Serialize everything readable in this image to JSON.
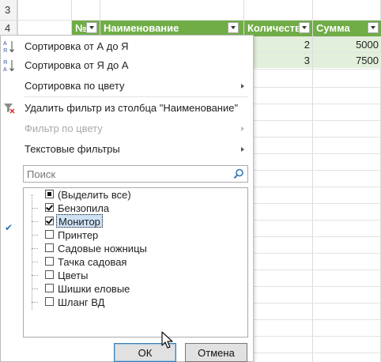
{
  "sheet": {
    "row_numbers": [
      "3",
      "4"
    ],
    "headers": [
      {
        "label": "№"
      },
      {
        "label": "Наименование"
      },
      {
        "label": "Количеств"
      },
      {
        "label": "Сумма"
      }
    ],
    "data_rows": [
      {
        "qty": "2",
        "sum": "5000"
      },
      {
        "qty": "3",
        "sum": "7500"
      }
    ],
    "header_color": "#70ad47",
    "row_band_color": "#e2efda"
  },
  "menu": {
    "sort_asc": "Сортировка от А до Я",
    "sort_desc": "Сортировка от Я до А",
    "sort_color": "Сортировка по цвету",
    "clear_filter": "Удалить фильтр из столбца \"Наименование\"",
    "filter_color": "Фильтр по цвету",
    "text_filters": "Текстовые фильтры",
    "search_placeholder": "Поиск",
    "items": [
      {
        "label": "(Выделить все)",
        "state": "partial"
      },
      {
        "label": "Бензопила",
        "state": "checked"
      },
      {
        "label": "Монитор",
        "state": "checked"
      },
      {
        "label": "Принтер",
        "state": "unchecked"
      },
      {
        "label": "Садовые ножницы",
        "state": "unchecked"
      },
      {
        "label": "Тачка садовая",
        "state": "unchecked"
      },
      {
        "label": "Цветы",
        "state": "unchecked"
      },
      {
        "label": "Шишки еловые",
        "state": "unchecked"
      },
      {
        "label": "Шланг ВД",
        "state": "unchecked"
      }
    ],
    "ok_label": "ОК",
    "cancel_label": "Отмена"
  },
  "icons": [
    "sort-az-icon",
    "sort-za-icon",
    "clear-filter-icon",
    "search-icon",
    "filter-active-icon",
    "dropdown-arrow-icon",
    "mouse-cursor-icon"
  ]
}
